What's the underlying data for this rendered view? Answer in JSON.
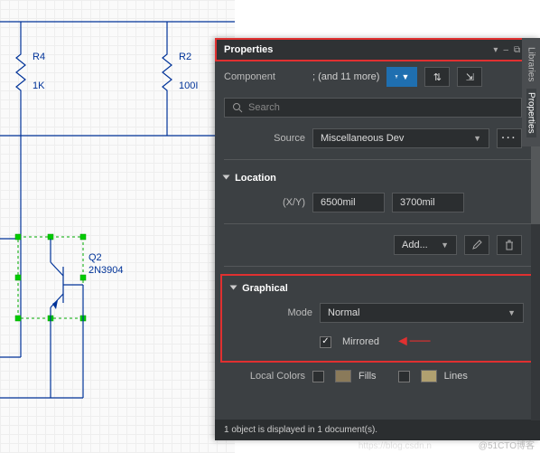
{
  "schematic": {
    "r4": {
      "ref": "R4",
      "val": "1K"
    },
    "r2": {
      "ref": "R2",
      "val": "100I"
    },
    "q2": {
      "ref": "Q2",
      "val": "2N3904"
    }
  },
  "vtabs": {
    "a": "Libraries",
    "b": "Properties"
  },
  "panel": {
    "title": "Properties",
    "ctrl": {
      "pin": "▾",
      "minus": "–",
      "rect": "⧉",
      "close": "×"
    },
    "component": {
      "label": "Component",
      "suffix": "; (and 11 more)"
    },
    "filter_icon": "filter-icon",
    "toolbar": {
      "a": "⇅",
      "b": "⇲"
    },
    "search": {
      "placeholder": "Search"
    },
    "source": {
      "label": "Source",
      "value": "Miscellaneous Dev"
    },
    "location": {
      "header": "Location",
      "xy": "(X/Y)",
      "x": "6500mil",
      "y": "3700mil",
      "add": "Add..."
    },
    "graphical": {
      "header": "Graphical",
      "mode_label": "Mode",
      "mode_value": "Normal",
      "mirrored_label": "Mirrored"
    },
    "local_colors": {
      "label": "Local Colors",
      "fills": "Fills",
      "lines": "Lines"
    },
    "status": "1 object is displayed in 1 document(s)."
  },
  "watermark": "@51CTO博客",
  "watermark2": "https://blog.csdn.n"
}
